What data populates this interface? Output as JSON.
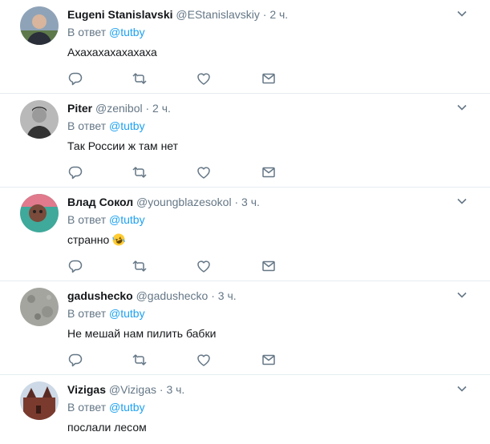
{
  "tweets": [
    {
      "name": "Eugeni Stanislavski",
      "handle": "@EStanislavskiy",
      "time": "2 ч.",
      "reply_label": "В ответ",
      "reply_mention": "@tutby",
      "text": "Ахахахахахахаха"
    },
    {
      "name": "Piter",
      "handle": "@zenibol",
      "time": "2 ч.",
      "reply_label": "В ответ",
      "reply_mention": "@tutby",
      "text": "Так России ж там нет"
    },
    {
      "name": "Влад Сокол",
      "handle": "@youngblazesokol",
      "time": "3 ч.",
      "reply_label": "В ответ",
      "reply_mention": "@tutby",
      "text": "странно",
      "emoji": "rolling-on-floor-laughing-emoji"
    },
    {
      "name": "gadushecko",
      "handle": "@gadushecko",
      "time": "3 ч.",
      "reply_label": "В ответ",
      "reply_mention": "@tutby",
      "text": "Не мешай нам пилить бабки"
    },
    {
      "name": "Vizigas",
      "handle": "@Vizigas",
      "time": "3 ч.",
      "reply_label": "В ответ",
      "reply_mention": "@tutby",
      "text": "послали лесом"
    }
  ],
  "separator": "·",
  "colors": {
    "link": "#1da1f2",
    "muted": "#657786",
    "text": "#14171a",
    "border": "#e6ecf0"
  },
  "icons": [
    "reply-icon",
    "retweet-icon",
    "like-icon",
    "message-icon",
    "chevron-down-icon"
  ]
}
